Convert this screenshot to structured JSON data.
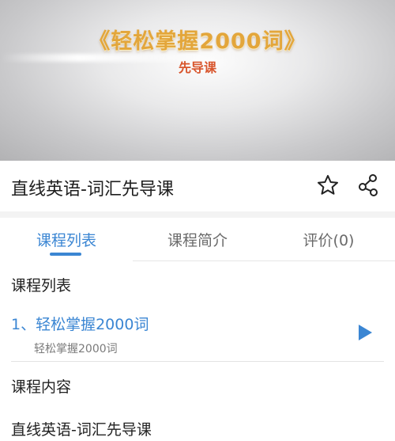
{
  "video": {
    "title": "《轻松掌握2000词》",
    "subtitle": "先导课"
  },
  "course": {
    "title": "直线英语-词汇先导课",
    "favorite_icon": "star-icon",
    "share_icon": "share-icon"
  },
  "tabs": [
    {
      "label": "课程列表",
      "active": true
    },
    {
      "label": "课程简介",
      "active": false
    },
    {
      "label": "评价(0)",
      "active": false
    }
  ],
  "list_section": {
    "heading": "课程列表",
    "lessons": [
      {
        "title": "1、轻松掌握2000词",
        "subtitle": "轻松掌握2000词",
        "action_icon": "play-icon"
      }
    ]
  },
  "content_section": {
    "heading": "课程内容",
    "text": "直线英语-词汇先导课"
  },
  "colors": {
    "accent": "#3b86d3",
    "video_title": "#e3a63b",
    "video_subtitle": "#d8552c"
  }
}
